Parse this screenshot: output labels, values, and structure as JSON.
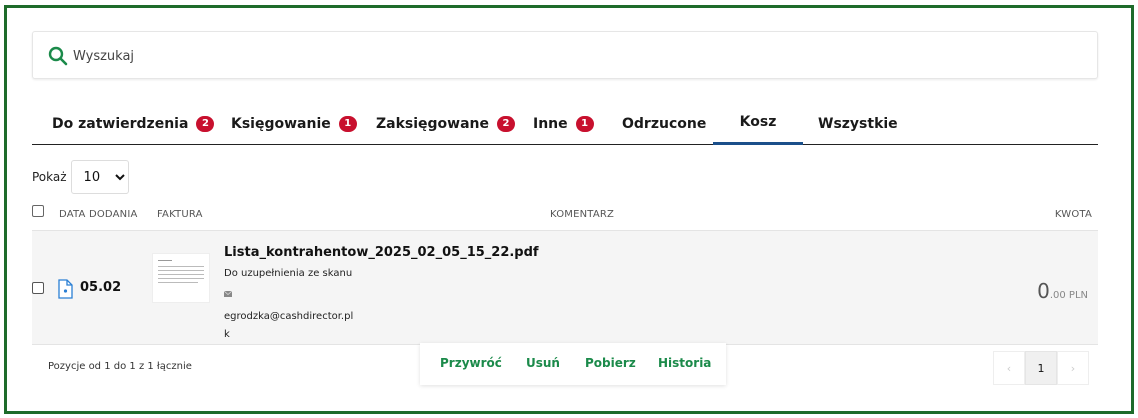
{
  "search": {
    "placeholder": "Wyszukaj"
  },
  "tabs": [
    {
      "label": "Do zatwierdzenia",
      "badge": "2"
    },
    {
      "label": "Księgowanie",
      "badge": "1"
    },
    {
      "label": "Zaksięgowane",
      "badge": "2"
    },
    {
      "label": "Inne",
      "badge": "1"
    },
    {
      "label": "Odrzucone",
      "badge": ""
    },
    {
      "label": "Kosz",
      "badge": ""
    },
    {
      "label": "Wszystkie",
      "badge": ""
    }
  ],
  "active_tab": "Kosz",
  "show": {
    "label": "Pokaż",
    "value": "10",
    "options": [
      "10"
    ]
  },
  "table": {
    "headers": {
      "date": "DATA DODANIA",
      "invoice": "FAKTURA",
      "comment": "KOMENTARZ",
      "amount": "KWOTA"
    },
    "rows": [
      {
        "date": "05.02",
        "filename": "Lista_kontrahentow_2025_02_05_15_22.pdf",
        "comment": "Do uzupełnienia ze skanu",
        "email": "egrodzka@cashdirector.pl",
        "email_tail": "k",
        "amount_main": "0",
        "amount_decimals": ".00 PLN"
      }
    ]
  },
  "footer": {
    "summary": "Pozycje od 1 do 1 z 1 łącznie"
  },
  "actions": {
    "restore": "Przywróć",
    "delete": "Usuń",
    "download": "Pobierz",
    "history": "Historia"
  },
  "pagination": {
    "prev": "‹",
    "current": "1",
    "next": "›"
  },
  "colors": {
    "frame": "#1e6b2a",
    "accent_green": "#1b8a4a",
    "badge_red": "#c8102e",
    "active_tab_underline": "#1b4f8a"
  }
}
